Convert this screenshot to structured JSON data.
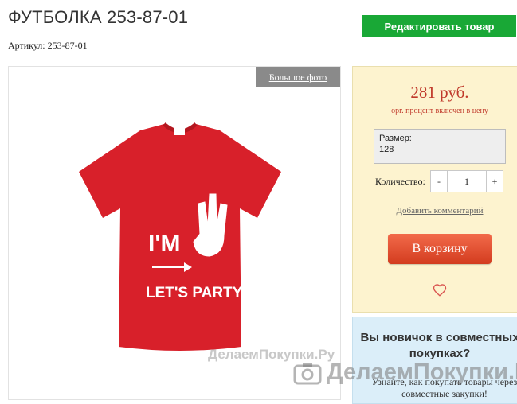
{
  "product": {
    "title": "ФУТБОЛКА 253-87-01",
    "article": "Артикул: 253-87-01",
    "edit_label": "Редактировать товар"
  },
  "photo": {
    "big_photo_label": "Большое фото",
    "watermark": "ДелаемПокупки.Ру",
    "print_line1": "I'M",
    "print_line2": "LET'S PARTY!"
  },
  "purchase": {
    "price": "281 руб.",
    "fee_note": "орг. процент включен в цену",
    "size_label": "Размер:",
    "size_value": "128",
    "qty_label": "Количество:",
    "qty_minus": "-",
    "qty_value": "1",
    "qty_plus": "+",
    "comment_link": "Добавить комментарий",
    "cart_label": "В корзину",
    "heart_icon": "heart-outline"
  },
  "newbie": {
    "title": "Вы новичок в совместных покупках?",
    "text": "Узнайте, как покупать товары через совместные закупки!"
  },
  "overlay_watermark": "ДелаемПокупки.Ру",
  "colors": {
    "accent_green": "#19a836",
    "price_red": "#c0392b",
    "cart_button": "#e14a2c",
    "shirt_red": "#d8202a"
  }
}
